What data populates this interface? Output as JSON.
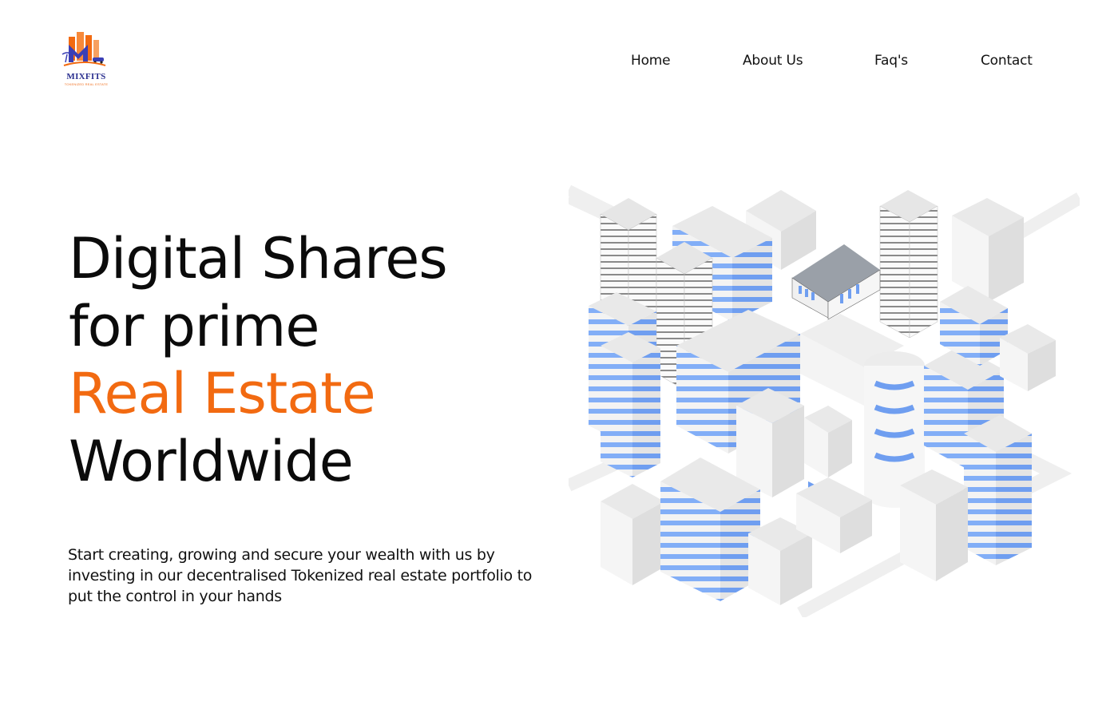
{
  "brand": {
    "name": "MIXFITS",
    "tagline": "TOKENIZED REAL ESTATE",
    "colors": {
      "primary": "#2a2f8f",
      "accent": "#f26a11"
    }
  },
  "nav": {
    "items": [
      {
        "label": "Home"
      },
      {
        "label": "About Us"
      },
      {
        "label": "Faq's"
      },
      {
        "label": "Contact"
      }
    ]
  },
  "hero": {
    "title_lines": [
      "Digital Shares",
      "for prime",
      "Real Estate",
      "Worldwide"
    ],
    "description": "Start creating, growing and secure your wealth with us by investing in our decentralised Tokenized real estate portfolio to put the control in your hands"
  },
  "illustration": {
    "icon": "isometric-city-illustration",
    "colors": {
      "building": "#ececec",
      "window": "#82aef7",
      "road": "#f1f1f1"
    }
  }
}
